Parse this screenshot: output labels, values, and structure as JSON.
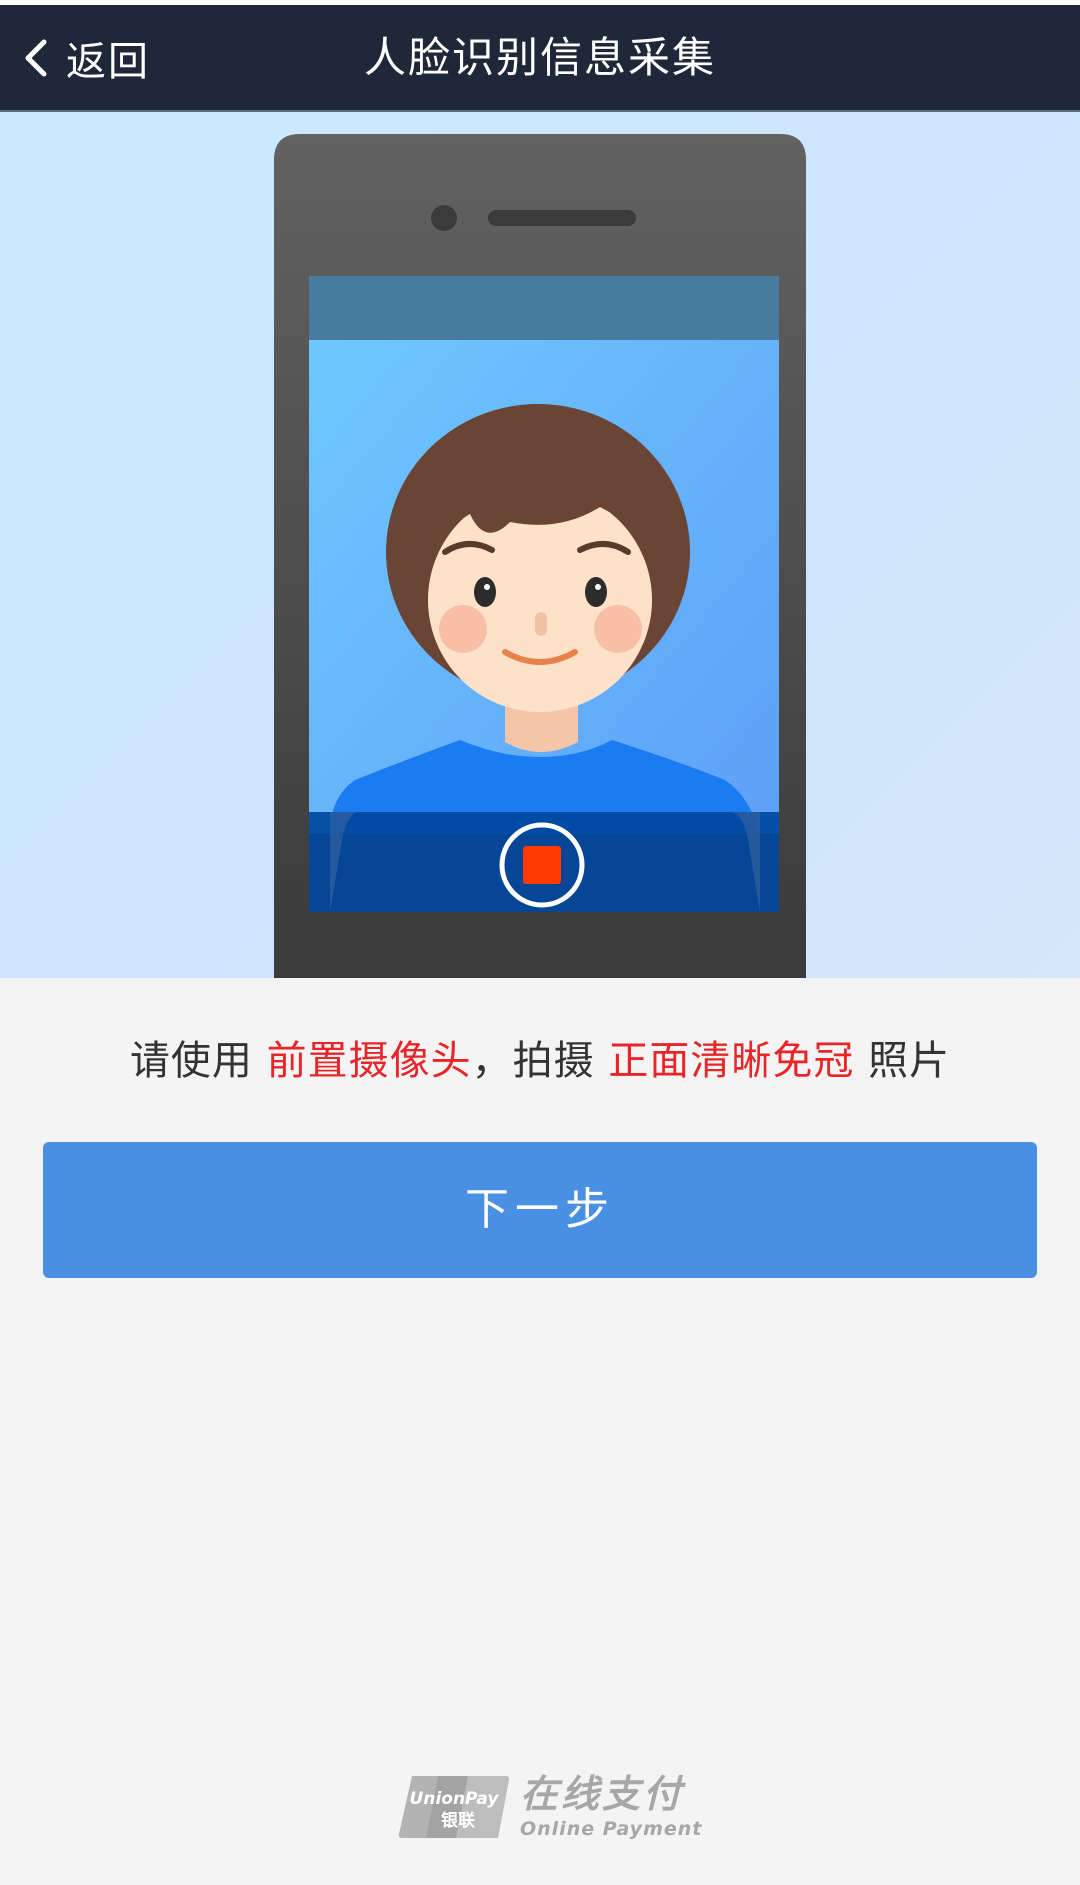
{
  "navbar": {
    "back_label": "返回",
    "title": "人脸识别信息采集",
    "background": "#1f2838"
  },
  "instruction": {
    "part1": "请使用 ",
    "highlight1": "前置摄像头",
    "part2": "，拍摄 ",
    "highlight2": "正面清晰免冠",
    "part3": " 照片",
    "highlight_color": "#e8262a"
  },
  "next_button": {
    "label": "下一步",
    "color": "#4a90e2"
  },
  "footer": {
    "logo_text_cn": "在线支付",
    "logo_text_en": "Online Payment",
    "logo_badge_en": "UnionPay",
    "logo_badge_cn": "银联"
  },
  "icons": {
    "back": "chevron-left-icon",
    "record": "record-stop-icon"
  }
}
